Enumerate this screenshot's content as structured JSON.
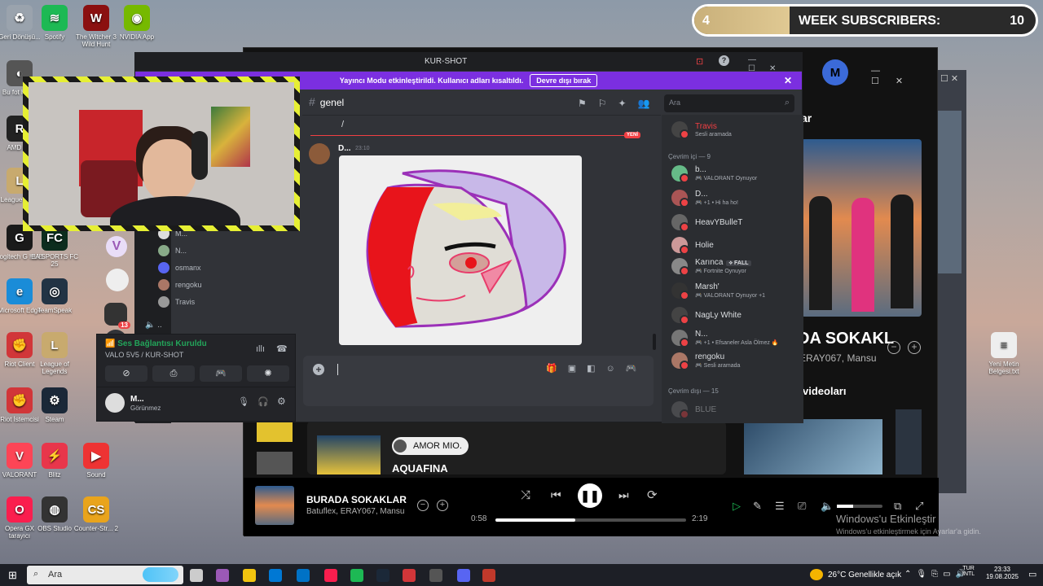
{
  "subscribers": {
    "left_value": "4",
    "label": "WEEK SUBSCRIBERS:",
    "right_value": "10",
    "progress": 0.28
  },
  "desktop_icons": [
    {
      "label": "Geri Dönüşü...",
      "color": "#9aa3ad",
      "glyph": "♻"
    },
    {
      "label": "Spotify",
      "color": "#1db954",
      "glyph": "≋"
    },
    {
      "label": "The Witcher 3 Wild Hunt",
      "color": "#8b1010",
      "glyph": "W"
    },
    {
      "label": "NVIDIA App",
      "color": "#76b900",
      "glyph": "◉"
    },
    {
      "label": "Bu fot hakkı",
      "color": "#555",
      "glyph": "◐"
    },
    {
      "label": "AMD Ma",
      "color": "#222",
      "glyph": "R"
    },
    {
      "label": "League Lege",
      "color": "#c8aa6e",
      "glyph": "L"
    },
    {
      "label": "Logitech G HUB",
      "color": "#1a1a1a",
      "glyph": "G"
    },
    {
      "label": "EA SPORTS FC 25",
      "color": "#0c2d1e",
      "glyph": "FC"
    },
    {
      "label": "Microsoft Edge",
      "color": "#1a8cd8",
      "glyph": "e"
    },
    {
      "label": "TeamSpeak",
      "color": "#234",
      "glyph": "◎"
    },
    {
      "label": "Riot Client",
      "color": "#d13639",
      "glyph": "✊"
    },
    {
      "label": "League of Legends",
      "color": "#c8aa6e",
      "glyph": "L"
    },
    {
      "label": "Riot İstemcisi",
      "color": "#d13639",
      "glyph": "✊"
    },
    {
      "label": "Steam",
      "color": "#1b2838",
      "glyph": "⚙"
    },
    {
      "label": "VALORANT",
      "color": "#fd4556",
      "glyph": "V"
    },
    {
      "label": "Blitz",
      "color": "#e8364b",
      "glyph": "⚡"
    },
    {
      "label": "Sound",
      "color": "#e33",
      "glyph": "▶"
    },
    {
      "label": "Opera GX tarayıcı",
      "color": "#fa1e4e",
      "glyph": "O"
    },
    {
      "label": "OBS Studio",
      "color": "#333",
      "glyph": "◍"
    },
    {
      "label": "Counter-Str... 2",
      "color": "#e9a41c",
      "glyph": "CS"
    },
    {
      "label": "Yeni Metin Belgesi.txt",
      "color": "#eee",
      "glyph": "≡"
    }
  ],
  "discord": {
    "title": "KUR-SHOT",
    "banner_text": "Yayıncı Modu etkinleştirildi. Kullanıcı adları kısaltıldı.",
    "banner_button": "Devre dışı bırak",
    "channel": "genel",
    "search_placeholder": "Ara",
    "prev_msg": "/",
    "new_badge": "YENİ",
    "message_author": "D...",
    "message_time": "23:10",
    "voice_users": [
      "M...",
      "N...",
      "osmanx",
      "rengoku",
      "Travis"
    ],
    "server_badge": "13",
    "voice_status": "Ses Bağlantısı Kuruldu",
    "voice_channel": "VALO 5V5 / KUR-SHOT",
    "user_name": "M...",
    "user_status": "Görünmez",
    "members_top": {
      "name": "Travis",
      "activity": "Sesli aramada"
    },
    "online_header": "Çevrim içi — 9",
    "members": [
      {
        "name": "b...",
        "activity": "VALORANT Oynuyor",
        "color": "#6b8"
      },
      {
        "name": "D...",
        "activity": "+1 • Hi ha ho!",
        "color": "#a55"
      },
      {
        "name": "HeavYBulleT",
        "activity": "",
        "color": "#666"
      },
      {
        "name": "Holie",
        "activity": "",
        "color": "#c99"
      },
      {
        "name": "Karınca",
        "activity": "Fortnite Oynuyor",
        "tag": "FALL",
        "color": "#888"
      },
      {
        "name": "Marsh'",
        "activity": "VALORANT Oynuyor +1",
        "color": "#333"
      },
      {
        "name": "NagLy White",
        "activity": "",
        "color": "#444"
      },
      {
        "name": "N...",
        "activity": "+1 • Efsaneler Asla Ölmez 🔥",
        "color": "#777"
      },
      {
        "name": "rengoku",
        "activity": "Sesli aramada",
        "color": "#a76"
      }
    ],
    "offline_header": "Çevrim dışı — 15",
    "offline_first": "BLUE"
  },
  "spotify": {
    "avatar_letter": "M",
    "header_fragment": "ar",
    "song_fragment": "DA SOKAKL",
    "artist_fragment": "ERAY067, Mansu",
    "videos_fragment": "videoları",
    "card_label": "AMOR MIO.",
    "card_title": "AQUAFINA",
    "now_playing_title": "BURADA SOKAKLAR",
    "now_playing_artist": "Batuflex, ERAY067, Mansu",
    "time_elapsed": "0:58",
    "time_total": "2:19",
    "progress": 0.42
  },
  "watermark": {
    "line1": "Windows'u Etkinleştir",
    "line2": "Windows'u etkinleştirmek için Ayarlar'a gidin."
  },
  "taskbar": {
    "search": "Ara",
    "weather": "26°C  Genellikle açık",
    "lang1": "TUR",
    "lang2": "INTL",
    "time": "23:33",
    "date": "19.08.2025"
  }
}
